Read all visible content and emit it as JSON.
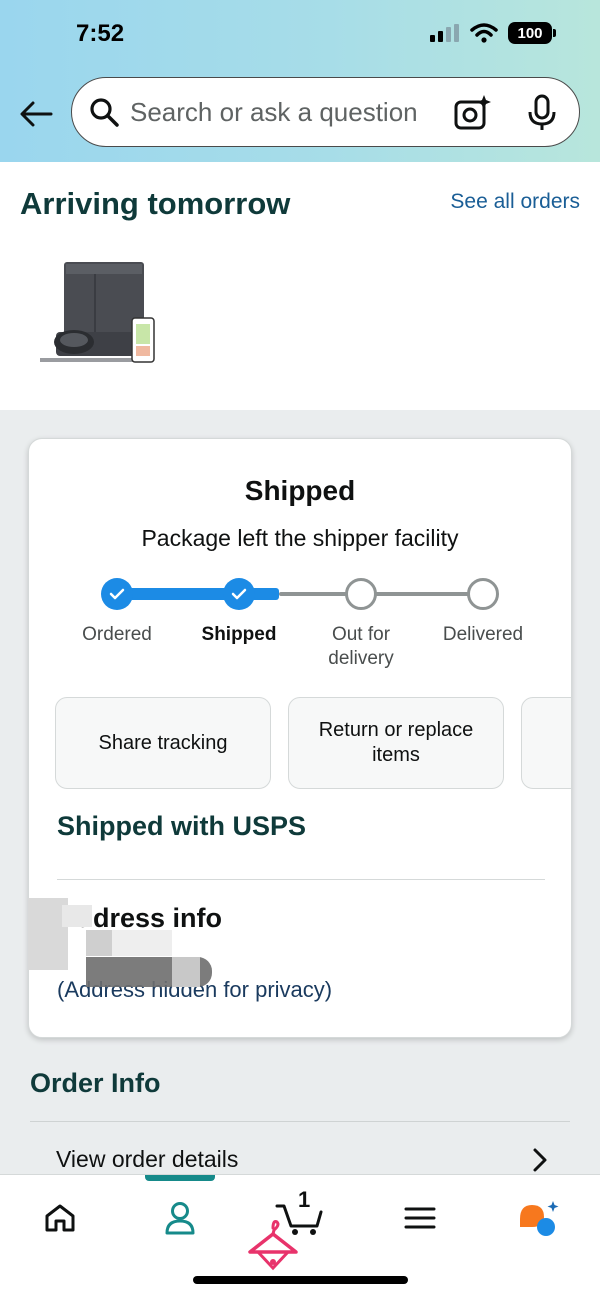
{
  "status_bar": {
    "time": "7:52",
    "battery": "100"
  },
  "search": {
    "placeholder": "Search or ask a question"
  },
  "arriving": {
    "title": "Arriving tomorrow",
    "see_all": "See all orders"
  },
  "card": {
    "status_title": "Shipped",
    "status_subtitle": "Package left the shipper facility",
    "steps": [
      {
        "label": "Ordered",
        "state": "done"
      },
      {
        "label": "Shipped",
        "state": "done"
      },
      {
        "label": "Out for delivery",
        "state": "pending"
      },
      {
        "label": "Delivered",
        "state": "pending"
      }
    ],
    "actions": [
      {
        "label": "Share tracking"
      },
      {
        "label": "Return or replace items"
      }
    ],
    "carrier": "Shipped with USPS",
    "address_title": "Address info",
    "address_text": "(Address hidden for privacy)"
  },
  "order_info": {
    "title": "Order Info",
    "view_details": "View order details"
  },
  "bottom_nav": {
    "cart_count": "1"
  },
  "colors": {
    "accent_blue": "#1c8be5",
    "teal": "#168a8a",
    "link": "#1a5e96"
  }
}
